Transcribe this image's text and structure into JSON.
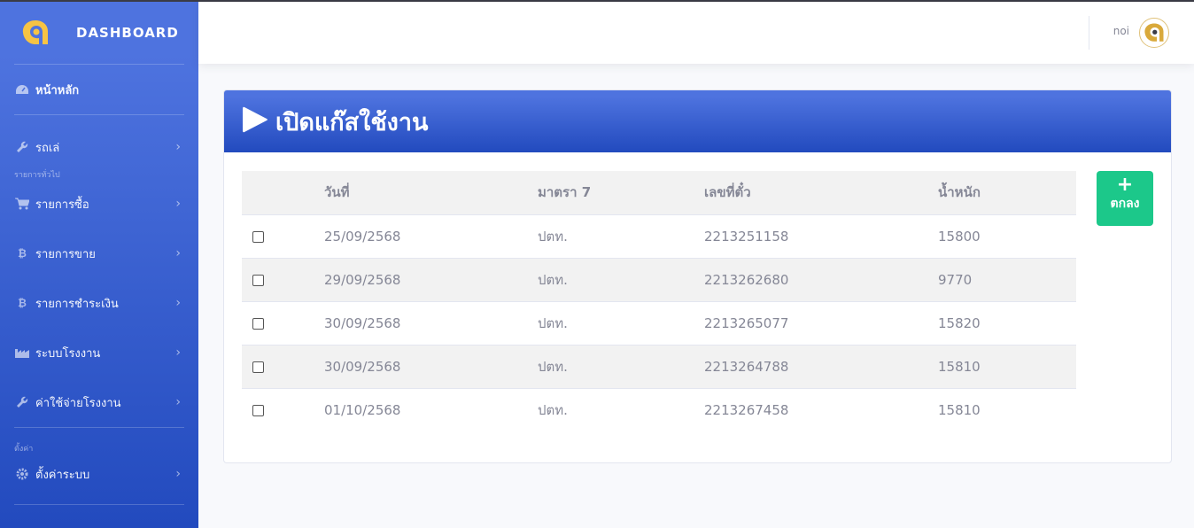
{
  "brand": {
    "title": "DASHBOARD"
  },
  "sidebar": {
    "home": "หน้าหลัก",
    "items": [
      {
        "label": "รถเล่",
        "icon": "wrench-icon"
      },
      {
        "label": "รายการซื้อ",
        "icon": "cart-icon"
      },
      {
        "label": "รายการขาย",
        "icon": "bitcoin-icon"
      },
      {
        "label": "รายการชำระเงิน",
        "icon": "bitcoin-icon"
      },
      {
        "label": "ระบบโรงงาน",
        "icon": "industry-icon"
      },
      {
        "label": "ค่าใช้จ่ายโรงงาน",
        "icon": "wrench-icon"
      },
      {
        "label": "ตั้งค่าระบบ",
        "icon": "gear-icon"
      }
    ],
    "heading_general": "รายการทั่วไป",
    "heading_settings": "ตั้งค่า"
  },
  "topbar": {
    "user_name": "noi"
  },
  "page": {
    "title": "เปิดแก๊สใช้งาน"
  },
  "table": {
    "headers": [
      "",
      "วันที่",
      "มาตรา 7",
      "เลขที่ตั๋ว",
      "น้ำหนัก"
    ],
    "rows": [
      {
        "date": "25/09/2568",
        "law": "ปตท.",
        "ticket": "2213251158",
        "weight": "15800"
      },
      {
        "date": "29/09/2568",
        "law": "ปตท.",
        "ticket": "2213262680",
        "weight": "9770"
      },
      {
        "date": "30/09/2568",
        "law": "ปตท.",
        "ticket": "2213265077",
        "weight": "15820"
      },
      {
        "date": "30/09/2568",
        "law": "ปตท.",
        "ticket": "2213264788",
        "weight": "15810"
      },
      {
        "date": "01/10/2568",
        "law": "ปตท.",
        "ticket": "2213267458",
        "weight": "15810"
      }
    ]
  },
  "actions": {
    "ok_label": "ตกลง",
    "ok_icon": "plus-icon"
  },
  "colors": {
    "primary": "#4e73df",
    "success": "#1cc88a",
    "text_muted": "#858796"
  }
}
